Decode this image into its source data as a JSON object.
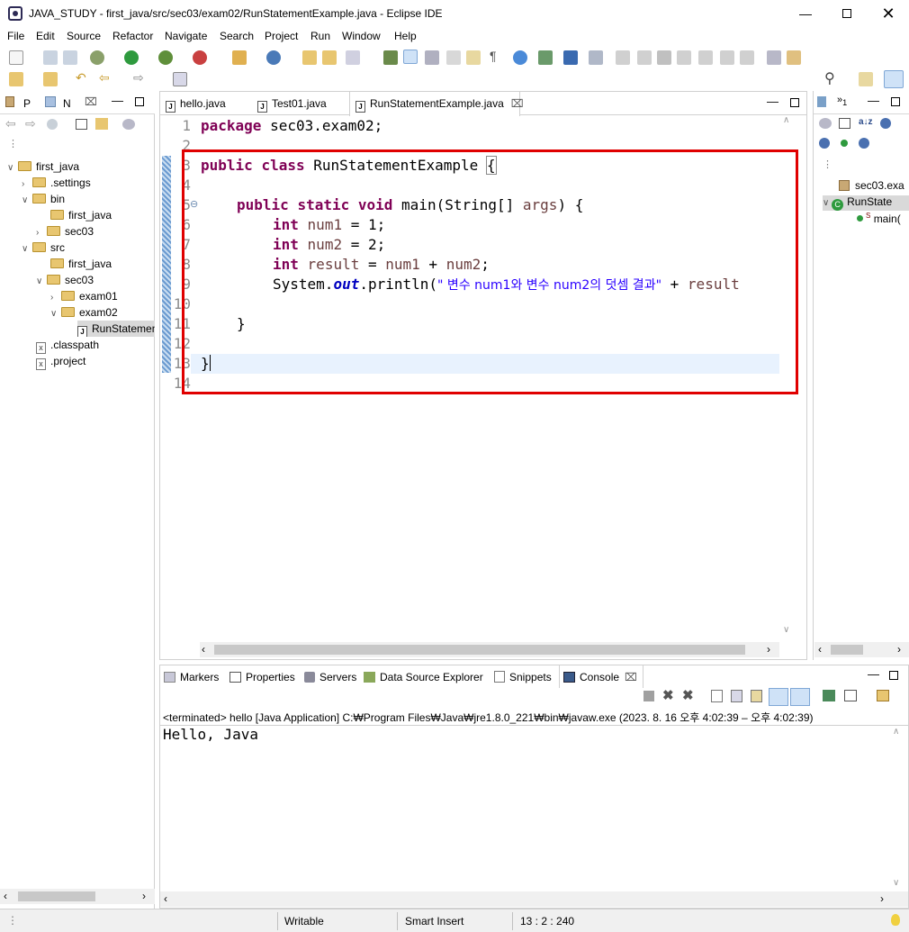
{
  "window": {
    "title": "JAVA_STUDY - first_java/src/sec03/exam02/RunStatementExample.java - Eclipse IDE"
  },
  "menu": [
    "File",
    "Edit",
    "Source",
    "Refactor",
    "Navigate",
    "Search",
    "Project",
    "Run",
    "Window",
    "Help"
  ],
  "left_panel": {
    "tabs": [
      "P",
      "N"
    ],
    "tree": [
      {
        "label": "first_java",
        "level": 0,
        "type": "project",
        "expanded": true
      },
      {
        "label": ".settings",
        "level": 1,
        "type": "folder",
        "expanded": false
      },
      {
        "label": "bin",
        "level": 1,
        "type": "folder",
        "expanded": true
      },
      {
        "label": "first_java",
        "level": 2,
        "type": "folder"
      },
      {
        "label": "sec03",
        "level": 2,
        "type": "folder",
        "expanded": false
      },
      {
        "label": "src",
        "level": 1,
        "type": "folder",
        "expanded": true
      },
      {
        "label": "first_java",
        "level": 2,
        "type": "folder"
      },
      {
        "label": "sec03",
        "level": 2,
        "type": "folder",
        "expanded": true
      },
      {
        "label": "exam01",
        "level": 3,
        "type": "folder",
        "expanded": false
      },
      {
        "label": "exam02",
        "level": 3,
        "type": "folder",
        "expanded": true
      },
      {
        "label": "RunStatemen",
        "level": 4,
        "type": "java"
      },
      {
        "label": ".classpath",
        "level": 1,
        "type": "xml"
      },
      {
        "label": ".project",
        "level": 1,
        "type": "xml"
      }
    ]
  },
  "editor": {
    "tabs": [
      {
        "label": "hello.java",
        "active": false
      },
      {
        "label": "Test01.java",
        "active": false
      },
      {
        "label": "RunStatementExample.java",
        "active": true
      }
    ],
    "line_numbers": [
      "1",
      "2",
      "3",
      "4",
      "5",
      "6",
      "7",
      "8",
      "9",
      "10",
      "11",
      "12",
      "13",
      "14"
    ],
    "code": {
      "l1_kw": "package",
      "l1_rest": " sec03.exam02;",
      "l3_kw1": "public",
      "l3_kw2": "class",
      "l3_rest": " RunStatementExample ",
      "l3_brace": "{",
      "l5_kw1": "public",
      "l5_kw2": "static",
      "l5_kw3": "void",
      "l5_rest": " main(String[] ",
      "l5_var": "args",
      "l5_end": ") {",
      "l6_kw": "int",
      "l6_var": "num1",
      "l6_rest": " = 1;",
      "l7_kw": "int",
      "l7_var": "num2",
      "l7_rest": " = 2;",
      "l8_kw": "int",
      "l8_var": "result",
      "l8_rest": " = ",
      "l8_v1": "num1",
      "l8_plus": " + ",
      "l8_v2": "num2",
      "l8_end": ";",
      "l9_a": "System.",
      "l9_out": "out",
      "l9_b": ".println(",
      "l9_str": "\" 변수 num1와 변수 num2의 덧셈 결과\"",
      "l9_c": " + ",
      "l9_var": "result",
      "l11": "}",
      "l13": "}"
    },
    "collapse_marker": "⊖"
  },
  "outline": {
    "items": [
      "sec03.exa",
      "RunState",
      "main("
    ],
    "method_badge": "S"
  },
  "bottom_panel": {
    "tabs": [
      "Markers",
      "Properties",
      "Servers",
      "Data Source Explorer",
      "Snippets",
      "Console"
    ],
    "console_header": "<terminated> hello [Java Application] C:₩Program Files₩Java₩jre1.8.0_221₩bin₩javaw.exe  (2023. 8. 16 오후 4:02:39 – 오후 4:02:39)",
    "console_output": "Hello, Java"
  },
  "status_bar": {
    "writable": "Writable",
    "insert_mode": "Smart Insert",
    "position": "13 : 2 : 240"
  },
  "colors": {
    "highlight_box": "#e00000",
    "keyword": "#7f0055",
    "string": "#2a00ff",
    "current_line": "#e8f2fe"
  }
}
